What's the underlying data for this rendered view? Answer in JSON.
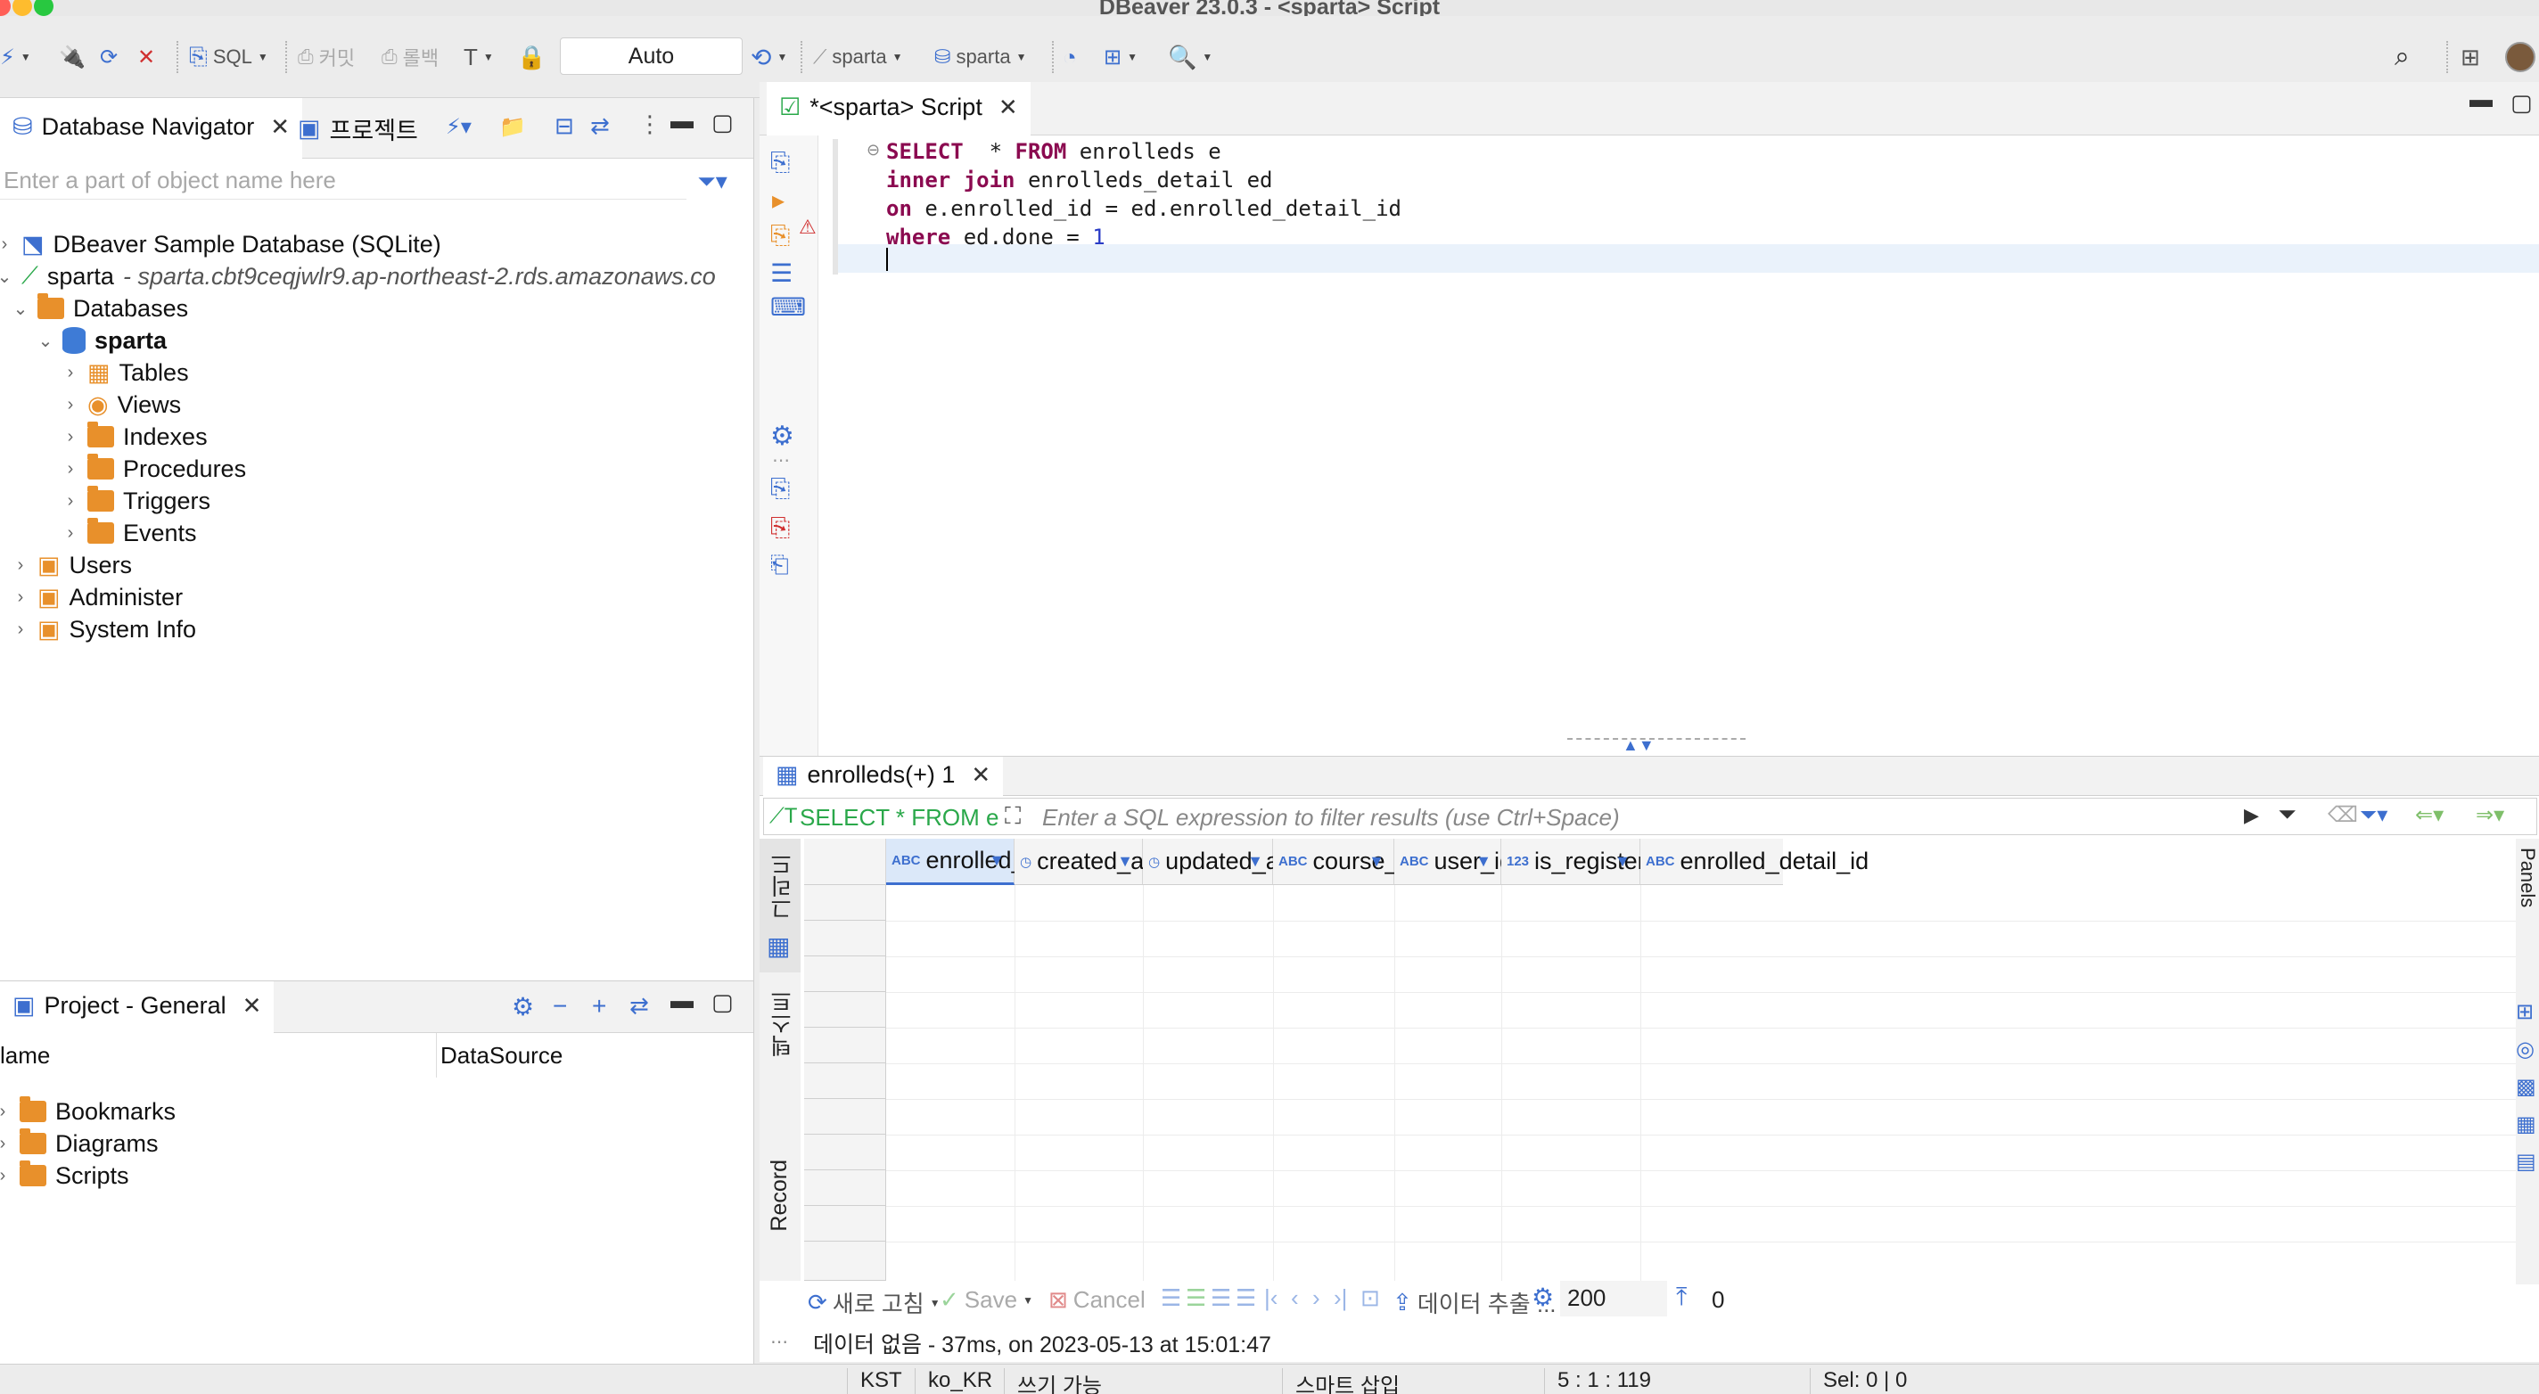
{
  "window": {
    "title": "DBeaver 23.0.3 - <sparta> Script"
  },
  "toolbar": {
    "sql_label": "SQL",
    "commit_label": "커밋",
    "rollback_label": "롤백",
    "transaction_mode": "Auto",
    "datasource_label": "sparta",
    "schema_label": "sparta"
  },
  "navigator": {
    "tab_label": "Database Navigator",
    "project_tab_label": "프로젝트",
    "filter_placeholder": "Enter a part of object name here",
    "nodes": {
      "sample_db": "DBeaver Sample Database (SQLite)",
      "conn_name": "sparta",
      "conn_host": " - sparta.cbt9ceqjwlr9.ap-northeast-2.rds.amazonaws.co",
      "databases": "Databases",
      "schema": "sparta",
      "tables": "Tables",
      "views": "Views",
      "indexes": "Indexes",
      "procedures": "Procedures",
      "triggers": "Triggers",
      "events": "Events",
      "users": "Users",
      "administer": "Administer",
      "system_info": "System Info"
    }
  },
  "project": {
    "tab_label": "Project - General",
    "col_name": "lame",
    "col_datasource": "DataSource",
    "items": {
      "bookmarks": "Bookmarks",
      "diagrams": "Diagrams",
      "scripts": "Scripts"
    }
  },
  "editor": {
    "tab_label": "*<sparta> Script",
    "lines": {
      "l1_kw1": "SELECT",
      "l1_rest1": "  * ",
      "l1_kw2": "FROM",
      "l1_rest2": " enrolleds e",
      "l2_kw": "inner join",
      "l2_rest": " enrolleds_detail ed",
      "l3_kw": "on",
      "l3_rest": " e.enrolled_id = ed.enrolled_detail_id",
      "l4_kw": "where",
      "l4_rest": " ed.done = ",
      "l4_num": "1"
    }
  },
  "results": {
    "tab_label": "enrolleds(+) 1",
    "query_preview": "SELECT * FROM enrolleds e inner joi",
    "filter_placeholder": "Enter a SQL expression to filter results (use Ctrl+Space)",
    "side_tabs": {
      "grid": "그리드",
      "text": "텍스트",
      "record": "Record"
    },
    "panels_label": "Panels",
    "columns": [
      {
        "type": "ABC",
        "name": "enrolled_id"
      },
      {
        "type": "clock",
        "name": "created_at"
      },
      {
        "type": "clock",
        "name": "updated_at"
      },
      {
        "type": "ABC",
        "name": "course_id"
      },
      {
        "type": "ABC",
        "name": "user_id"
      },
      {
        "type": "123",
        "name": "is_registered"
      },
      {
        "type": "ABC",
        "name": "enrolled_detail_id"
      }
    ],
    "bottom": {
      "refresh": "새로 고침",
      "save": "Save",
      "cancel": "Cancel",
      "export": "데이터 추출 ...",
      "fetch_size": "200",
      "row_count": "0"
    },
    "status": "데이터 없음 - 37ms, on 2023-05-13 at 15:01:47"
  },
  "statusbar": {
    "timezone": "KST",
    "locale": "ko_KR",
    "write_mode": "쓰기 가능",
    "insert_mode": "스마트 삽입",
    "position": "5 : 1 : 119",
    "selection": "Sel: 0 | 0"
  },
  "colors": {
    "accent": "#3d6fcf",
    "keyword": "#8b0a50",
    "folder": "#e8902b",
    "close": "#ff5f57",
    "minimize": "#febc2e",
    "zoom": "#28c840"
  }
}
